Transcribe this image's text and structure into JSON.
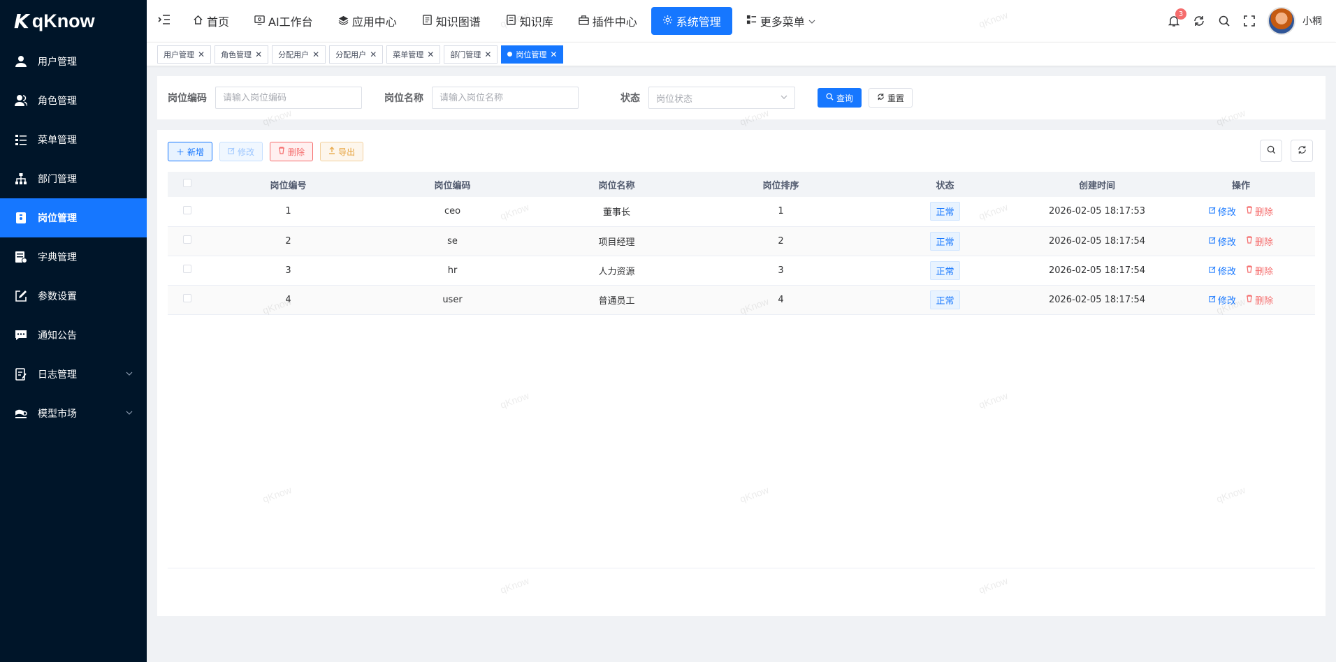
{
  "app": {
    "logo_mark": "K",
    "logo_text": "qKnow"
  },
  "sidebar": {
    "items": [
      {
        "label": "用户管理",
        "icon": "user-icon"
      },
      {
        "label": "角色管理",
        "icon": "role-icon"
      },
      {
        "label": "菜单管理",
        "icon": "menu-tree-icon"
      },
      {
        "label": "部门管理",
        "icon": "org-icon"
      },
      {
        "label": "岗位管理",
        "icon": "post-icon",
        "active": true
      },
      {
        "label": "字典管理",
        "icon": "dict-icon"
      },
      {
        "label": "参数设置",
        "icon": "edit-icon"
      },
      {
        "label": "通知公告",
        "icon": "message-icon"
      },
      {
        "label": "日志管理",
        "icon": "log-icon",
        "expandable": true
      },
      {
        "label": "模型市场",
        "icon": "model-icon",
        "expandable": true
      }
    ]
  },
  "header": {
    "nav": [
      {
        "label": "首页",
        "icon": "home-icon"
      },
      {
        "label": "AI工作台",
        "icon": "ai-icon"
      },
      {
        "label": "应用中心",
        "icon": "app-icon"
      },
      {
        "label": "知识图谱",
        "icon": "graph-icon"
      },
      {
        "label": "知识库",
        "icon": "book-icon"
      },
      {
        "label": "插件中心",
        "icon": "plugin-icon"
      },
      {
        "label": "系统管理",
        "icon": "gear-icon",
        "active": true
      },
      {
        "label": "更多菜单",
        "icon": "more-icon"
      }
    ],
    "notification_count": "3",
    "username": "小桐"
  },
  "tags": [
    {
      "label": "用户管理"
    },
    {
      "label": "角色管理"
    },
    {
      "label": "分配用户"
    },
    {
      "label": "分配用户"
    },
    {
      "label": "菜单管理"
    },
    {
      "label": "部门管理"
    },
    {
      "label": "岗位管理",
      "active": true
    }
  ],
  "search": {
    "post_code_label": "岗位编码",
    "post_code_placeholder": "请输入岗位编码",
    "post_name_label": "岗位名称",
    "post_name_placeholder": "请输入岗位名称",
    "status_label": "状态",
    "status_placeholder": "岗位状态",
    "query_label": "查询",
    "reset_label": "重置"
  },
  "toolbar": {
    "add_label": "新增",
    "edit_label": "修改",
    "delete_label": "删除",
    "export_label": "导出"
  },
  "table": {
    "columns": [
      "岗位编号",
      "岗位编码",
      "岗位名称",
      "岗位排序",
      "状态",
      "创建时间",
      "操作"
    ],
    "rows": [
      {
        "id": "1",
        "code": "ceo",
        "name": "董事长",
        "sort": "1",
        "status": "正常",
        "created": "2026-02-05 18:17:53"
      },
      {
        "id": "2",
        "code": "se",
        "name": "项目经理",
        "sort": "2",
        "status": "正常",
        "created": "2026-02-05 18:17:54"
      },
      {
        "id": "3",
        "code": "hr",
        "name": "人力资源",
        "sort": "3",
        "status": "正常",
        "created": "2026-02-05 18:17:54"
      },
      {
        "id": "4",
        "code": "user",
        "name": "普通员工",
        "sort": "4",
        "status": "正常",
        "created": "2026-02-05 18:17:54"
      }
    ],
    "edit_label": "修改",
    "delete_label": "删除"
  },
  "watermark": "qKnow",
  "colors": {
    "primary": "#1677ff",
    "sidebar_bg": "#001529",
    "danger": "#f56c6c",
    "warning": "#e6a23c"
  }
}
